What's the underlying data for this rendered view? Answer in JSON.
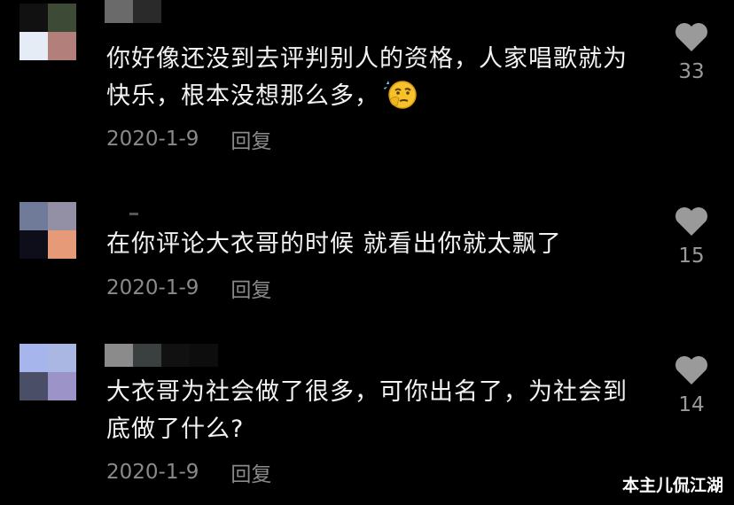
{
  "comments": [
    {
      "text": "你好像还没到去评判别人的资格，人家唱歌就为快乐，根本没想那么多，",
      "date": "2020-1-9",
      "reply": "回复",
      "likes": "33",
      "avatar_colors": [
        "#111111",
        "#3d4a36",
        "#e6ecf6",
        "#b27f7b"
      ],
      "name_colors": [
        "#6a6a6a",
        "#2a2a2a"
      ]
    },
    {
      "text": "在你评论大衣哥的时候 就看出你就太飘了",
      "date": "2020-1-9",
      "reply": "回复",
      "likes": "15",
      "avatar_colors": [
        "#707b9a",
        "#9390a6",
        "#0d0e1a",
        "#e79a78"
      ],
      "name_colors": []
    },
    {
      "text": "大衣哥为社会做了很多，可你出名了，为社会到底做了什么?",
      "date": "2020-1-9",
      "reply": "回复",
      "likes": "14",
      "avatar_colors": [
        "#a6b6ec",
        "#a9b7e2",
        "#4a4e67",
        "#9c93c8"
      ],
      "name_colors": [
        "#8b8b8b",
        "#3a3f3f",
        "#111111",
        "#0d0d0d"
      ]
    }
  ],
  "watermark": "本主儿侃江湖",
  "colors": {
    "background": "#000000",
    "text": "#f2f2f2",
    "meta": "#8a8a8a",
    "heart": "#9a9a9a"
  },
  "icons": {
    "like": "heart-icon",
    "emoji": "thinking-face-emoji-icon"
  }
}
